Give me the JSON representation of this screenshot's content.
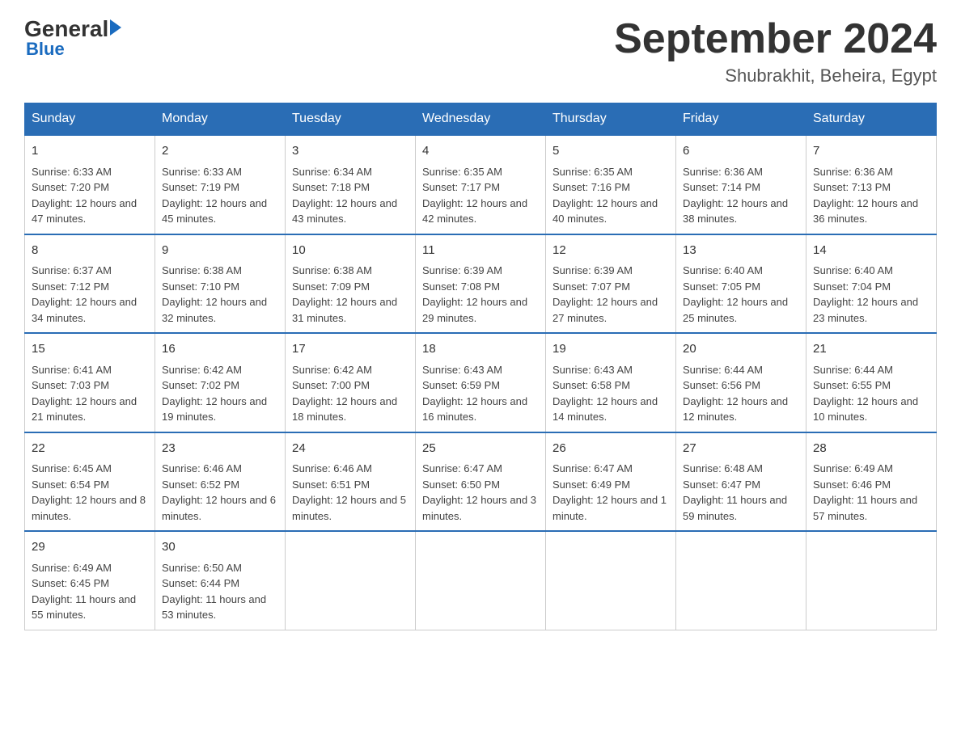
{
  "logo": {
    "general": "General",
    "blue": "Blue"
  },
  "title": "September 2024",
  "subtitle": "Shubrakhit, Beheira, Egypt",
  "days_of_week": [
    "Sunday",
    "Monday",
    "Tuesday",
    "Wednesday",
    "Thursday",
    "Friday",
    "Saturday"
  ],
  "weeks": [
    [
      {
        "day": "1",
        "sunrise": "Sunrise: 6:33 AM",
        "sunset": "Sunset: 7:20 PM",
        "daylight": "Daylight: 12 hours and 47 minutes."
      },
      {
        "day": "2",
        "sunrise": "Sunrise: 6:33 AM",
        "sunset": "Sunset: 7:19 PM",
        "daylight": "Daylight: 12 hours and 45 minutes."
      },
      {
        "day": "3",
        "sunrise": "Sunrise: 6:34 AM",
        "sunset": "Sunset: 7:18 PM",
        "daylight": "Daylight: 12 hours and 43 minutes."
      },
      {
        "day": "4",
        "sunrise": "Sunrise: 6:35 AM",
        "sunset": "Sunset: 7:17 PM",
        "daylight": "Daylight: 12 hours and 42 minutes."
      },
      {
        "day": "5",
        "sunrise": "Sunrise: 6:35 AM",
        "sunset": "Sunset: 7:16 PM",
        "daylight": "Daylight: 12 hours and 40 minutes."
      },
      {
        "day": "6",
        "sunrise": "Sunrise: 6:36 AM",
        "sunset": "Sunset: 7:14 PM",
        "daylight": "Daylight: 12 hours and 38 minutes."
      },
      {
        "day": "7",
        "sunrise": "Sunrise: 6:36 AM",
        "sunset": "Sunset: 7:13 PM",
        "daylight": "Daylight: 12 hours and 36 minutes."
      }
    ],
    [
      {
        "day": "8",
        "sunrise": "Sunrise: 6:37 AM",
        "sunset": "Sunset: 7:12 PM",
        "daylight": "Daylight: 12 hours and 34 minutes."
      },
      {
        "day": "9",
        "sunrise": "Sunrise: 6:38 AM",
        "sunset": "Sunset: 7:10 PM",
        "daylight": "Daylight: 12 hours and 32 minutes."
      },
      {
        "day": "10",
        "sunrise": "Sunrise: 6:38 AM",
        "sunset": "Sunset: 7:09 PM",
        "daylight": "Daylight: 12 hours and 31 minutes."
      },
      {
        "day": "11",
        "sunrise": "Sunrise: 6:39 AM",
        "sunset": "Sunset: 7:08 PM",
        "daylight": "Daylight: 12 hours and 29 minutes."
      },
      {
        "day": "12",
        "sunrise": "Sunrise: 6:39 AM",
        "sunset": "Sunset: 7:07 PM",
        "daylight": "Daylight: 12 hours and 27 minutes."
      },
      {
        "day": "13",
        "sunrise": "Sunrise: 6:40 AM",
        "sunset": "Sunset: 7:05 PM",
        "daylight": "Daylight: 12 hours and 25 minutes."
      },
      {
        "day": "14",
        "sunrise": "Sunrise: 6:40 AM",
        "sunset": "Sunset: 7:04 PM",
        "daylight": "Daylight: 12 hours and 23 minutes."
      }
    ],
    [
      {
        "day": "15",
        "sunrise": "Sunrise: 6:41 AM",
        "sunset": "Sunset: 7:03 PM",
        "daylight": "Daylight: 12 hours and 21 minutes."
      },
      {
        "day": "16",
        "sunrise": "Sunrise: 6:42 AM",
        "sunset": "Sunset: 7:02 PM",
        "daylight": "Daylight: 12 hours and 19 minutes."
      },
      {
        "day": "17",
        "sunrise": "Sunrise: 6:42 AM",
        "sunset": "Sunset: 7:00 PM",
        "daylight": "Daylight: 12 hours and 18 minutes."
      },
      {
        "day": "18",
        "sunrise": "Sunrise: 6:43 AM",
        "sunset": "Sunset: 6:59 PM",
        "daylight": "Daylight: 12 hours and 16 minutes."
      },
      {
        "day": "19",
        "sunrise": "Sunrise: 6:43 AM",
        "sunset": "Sunset: 6:58 PM",
        "daylight": "Daylight: 12 hours and 14 minutes."
      },
      {
        "day": "20",
        "sunrise": "Sunrise: 6:44 AM",
        "sunset": "Sunset: 6:56 PM",
        "daylight": "Daylight: 12 hours and 12 minutes."
      },
      {
        "day": "21",
        "sunrise": "Sunrise: 6:44 AM",
        "sunset": "Sunset: 6:55 PM",
        "daylight": "Daylight: 12 hours and 10 minutes."
      }
    ],
    [
      {
        "day": "22",
        "sunrise": "Sunrise: 6:45 AM",
        "sunset": "Sunset: 6:54 PM",
        "daylight": "Daylight: 12 hours and 8 minutes."
      },
      {
        "day": "23",
        "sunrise": "Sunrise: 6:46 AM",
        "sunset": "Sunset: 6:52 PM",
        "daylight": "Daylight: 12 hours and 6 minutes."
      },
      {
        "day": "24",
        "sunrise": "Sunrise: 6:46 AM",
        "sunset": "Sunset: 6:51 PM",
        "daylight": "Daylight: 12 hours and 5 minutes."
      },
      {
        "day": "25",
        "sunrise": "Sunrise: 6:47 AM",
        "sunset": "Sunset: 6:50 PM",
        "daylight": "Daylight: 12 hours and 3 minutes."
      },
      {
        "day": "26",
        "sunrise": "Sunrise: 6:47 AM",
        "sunset": "Sunset: 6:49 PM",
        "daylight": "Daylight: 12 hours and 1 minute."
      },
      {
        "day": "27",
        "sunrise": "Sunrise: 6:48 AM",
        "sunset": "Sunset: 6:47 PM",
        "daylight": "Daylight: 11 hours and 59 minutes."
      },
      {
        "day": "28",
        "sunrise": "Sunrise: 6:49 AM",
        "sunset": "Sunset: 6:46 PM",
        "daylight": "Daylight: 11 hours and 57 minutes."
      }
    ],
    [
      {
        "day": "29",
        "sunrise": "Sunrise: 6:49 AM",
        "sunset": "Sunset: 6:45 PM",
        "daylight": "Daylight: 11 hours and 55 minutes."
      },
      {
        "day": "30",
        "sunrise": "Sunrise: 6:50 AM",
        "sunset": "Sunset: 6:44 PM",
        "daylight": "Daylight: 11 hours and 53 minutes."
      },
      null,
      null,
      null,
      null,
      null
    ]
  ]
}
